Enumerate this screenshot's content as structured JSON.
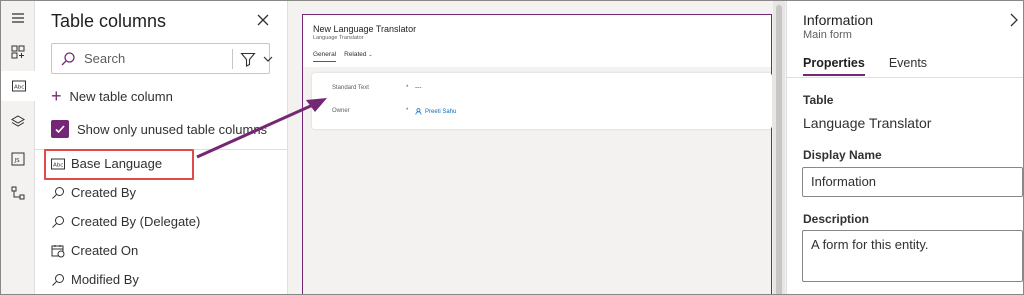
{
  "table_columns": {
    "title": "Table columns",
    "search_placeholder": "Search",
    "new_column_label": "New table column",
    "show_unused_label": "Show only unused table columns",
    "items": [
      {
        "label": "Base Language",
        "icon": "text-field-icon"
      },
      {
        "label": "Created By",
        "icon": "lookup-icon"
      },
      {
        "label": "Created By (Delegate)",
        "icon": "lookup-icon"
      },
      {
        "label": "Created On",
        "icon": "calendar-icon"
      },
      {
        "label": "Modified By",
        "icon": "lookup-icon"
      }
    ]
  },
  "form_preview": {
    "title": "New Language Translator",
    "subtitle": "Language Translator",
    "tabs": [
      "General",
      "Related"
    ],
    "fields": [
      {
        "label": "Standard Text",
        "required": "*",
        "value": "---"
      },
      {
        "label": "Owner",
        "required": "*",
        "value": "Preeti Sahu"
      }
    ]
  },
  "info_panel": {
    "title": "Information",
    "subtitle": "Main form",
    "tabs": [
      "Properties",
      "Events"
    ],
    "table_label": "Table",
    "table_value": "Language Translator",
    "display_name_label": "Display Name",
    "display_name_value": "Information",
    "description_label": "Description",
    "description_value": "A form for this entity."
  },
  "colors": {
    "accent": "#742774",
    "highlight_box": "#e04a4a",
    "link": "#0f6cbd"
  }
}
